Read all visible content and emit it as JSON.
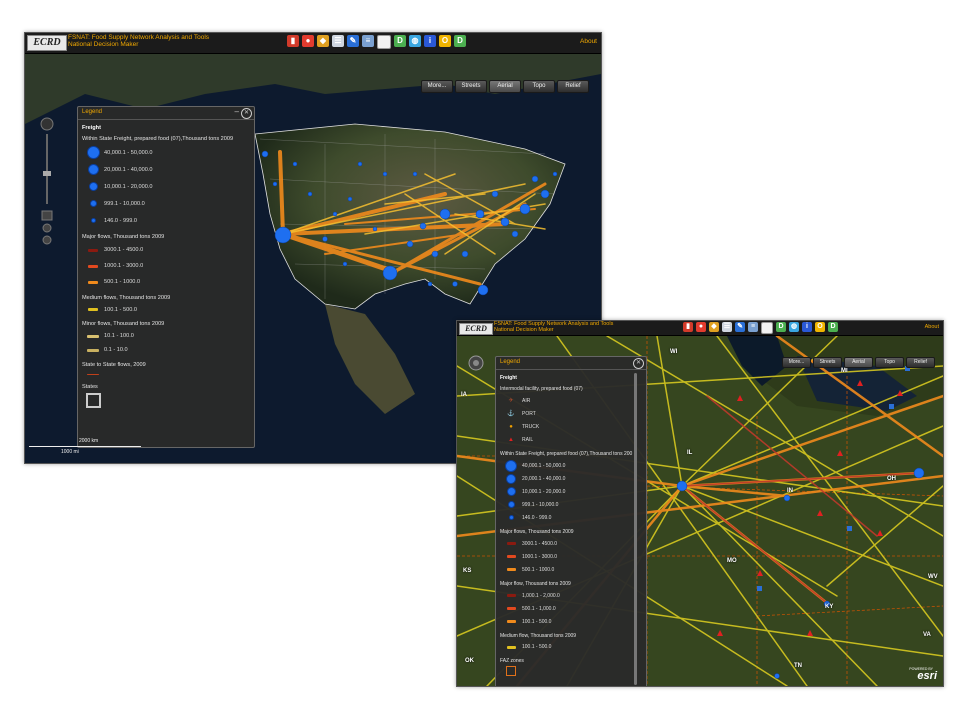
{
  "app": {
    "logo": "ECRD",
    "title_line1": "FSNAT: Food Supply Network Analysis and Tools",
    "title_line2": "National Decision Maker",
    "about": "About"
  },
  "toolbar_icons": [
    {
      "name": "bookmark-icon",
      "color": "#d23a2a",
      "glyph": "▮"
    },
    {
      "name": "stop-icon",
      "color": "#e23b2e",
      "glyph": "●"
    },
    {
      "name": "layers-icon",
      "color": "#e0a020",
      "glyph": "◆"
    },
    {
      "name": "list-icon",
      "color": "#cfd6e0",
      "glyph": "☰"
    },
    {
      "name": "tools-icon",
      "color": "#2a6fd6",
      "glyph": "✎"
    },
    {
      "name": "stack-icon",
      "color": "#7aa0d0",
      "glyph": "≡"
    },
    {
      "name": "blank-icon",
      "color": "#f2f2f2",
      "glyph": ""
    },
    {
      "name": "d-icon-1",
      "color": "#4caf50",
      "glyph": "D"
    },
    {
      "name": "globe-icon",
      "color": "#3aa6e0",
      "glyph": "◍"
    },
    {
      "name": "info-icon",
      "color": "#2a58d6",
      "glyph": "i"
    },
    {
      "name": "o-icon",
      "color": "#f0b400",
      "glyph": "O"
    },
    {
      "name": "d-icon-2",
      "color": "#4caf50",
      "glyph": "D"
    }
  ],
  "basemap_buttons": [
    "More...",
    "Streets",
    "Aerial",
    "Topo",
    "Relief"
  ],
  "basemap_active": "Aerial",
  "legend_back": {
    "title": "Legend",
    "section": "Freight",
    "within_state_title": "Within State Freight, prepared food (07),Thousand tons 2009",
    "within_state": [
      {
        "label": "40,000.1 - 50,000.0",
        "size": 11
      },
      {
        "label": "20,000.1 - 40,000.0",
        "size": 9
      },
      {
        "label": "10,000.1 - 20,000.0",
        "size": 7
      },
      {
        "label": "999.1 - 10,000.0",
        "size": 5
      },
      {
        "label": "146.0 - 999.0",
        "size": 3
      }
    ],
    "major_title": "Major flows, Thousand tons 2009",
    "major": [
      {
        "label": "3000.1 - 4500.0",
        "color": "#8b1a10"
      },
      {
        "label": "1000.1 - 3000.0",
        "color": "#e2491f"
      },
      {
        "label": "500.1 - 1000.0",
        "color": "#f08a1c"
      }
    ],
    "medium_title": "Medium flows, Thousand tons 2009",
    "medium": [
      {
        "label": "100.1 - 500.0",
        "color": "#e0c020"
      }
    ],
    "minor_title": "Minor flows, Thousand tons 2009",
    "minor": [
      {
        "label": "10.1 - 100.0",
        "color": "#d8c070"
      },
      {
        "label": "0.1 - 10.0",
        "color": "#c8b060"
      }
    ],
    "state_flows_title": "State to State flows, 2009",
    "states_title": "States"
  },
  "legend_front": {
    "title": "Legend",
    "section": "Freight",
    "facility_title": "Intermodal facility, prepared food (07)",
    "facilities": [
      {
        "label": "AIR",
        "glyph": "✈",
        "color": "#b04a2a"
      },
      {
        "label": "PORT",
        "glyph": "⚓",
        "color": "#2a6fd6"
      },
      {
        "label": "TRUCK",
        "glyph": "●",
        "color": "#f0a000"
      },
      {
        "label": "RAIL",
        "glyph": "▲",
        "color": "#e02020"
      }
    ],
    "within_state_title": "Within State Freight, prepared food (07),Thousand tons 200",
    "within_state": [
      {
        "label": "40,000.1 - 50,000.0",
        "size": 10
      },
      {
        "label": "20,000.1 - 40,000.0",
        "size": 8
      },
      {
        "label": "10,000.1 - 20,000.0",
        "size": 7
      },
      {
        "label": "999.1 - 10,000.0",
        "size": 5
      },
      {
        "label": "146.0 - 999.0",
        "size": 3
      }
    ],
    "major_title": "Major flows, Thousand tons 2009",
    "major": [
      {
        "label": "3000.1 - 4500.0",
        "color": "#8b1a10"
      },
      {
        "label": "1000.1 - 3000.0",
        "color": "#e2491f"
      },
      {
        "label": "500.1 - 1000.0",
        "color": "#f08a1c"
      }
    ],
    "major2_title": "Major flow, Thousand tons 2009",
    "major2": [
      {
        "label": "1,000.1 - 2,000.0",
        "color": "#8b1a10"
      },
      {
        "label": "500.1 - 1,000.0",
        "color": "#e2491f"
      },
      {
        "label": "100.1 - 500.0",
        "color": "#f08a1c"
      }
    ],
    "medium_title": "Medium flow, Thousand tons 2009",
    "medium": [
      {
        "label": "100.1 - 500.0",
        "color": "#e0c020"
      }
    ],
    "faz_title": "FAZ zones"
  },
  "scale": {
    "km": "2000 km",
    "mi": "1000 mi"
  },
  "state_labels": [
    "WI",
    "MI",
    "IA",
    "IL",
    "IN",
    "OH",
    "KS",
    "MO",
    "KY",
    "WV",
    "VA",
    "OK",
    "TN"
  ],
  "attribution": {
    "powered": "POWERED BY",
    "brand": "esri"
  }
}
